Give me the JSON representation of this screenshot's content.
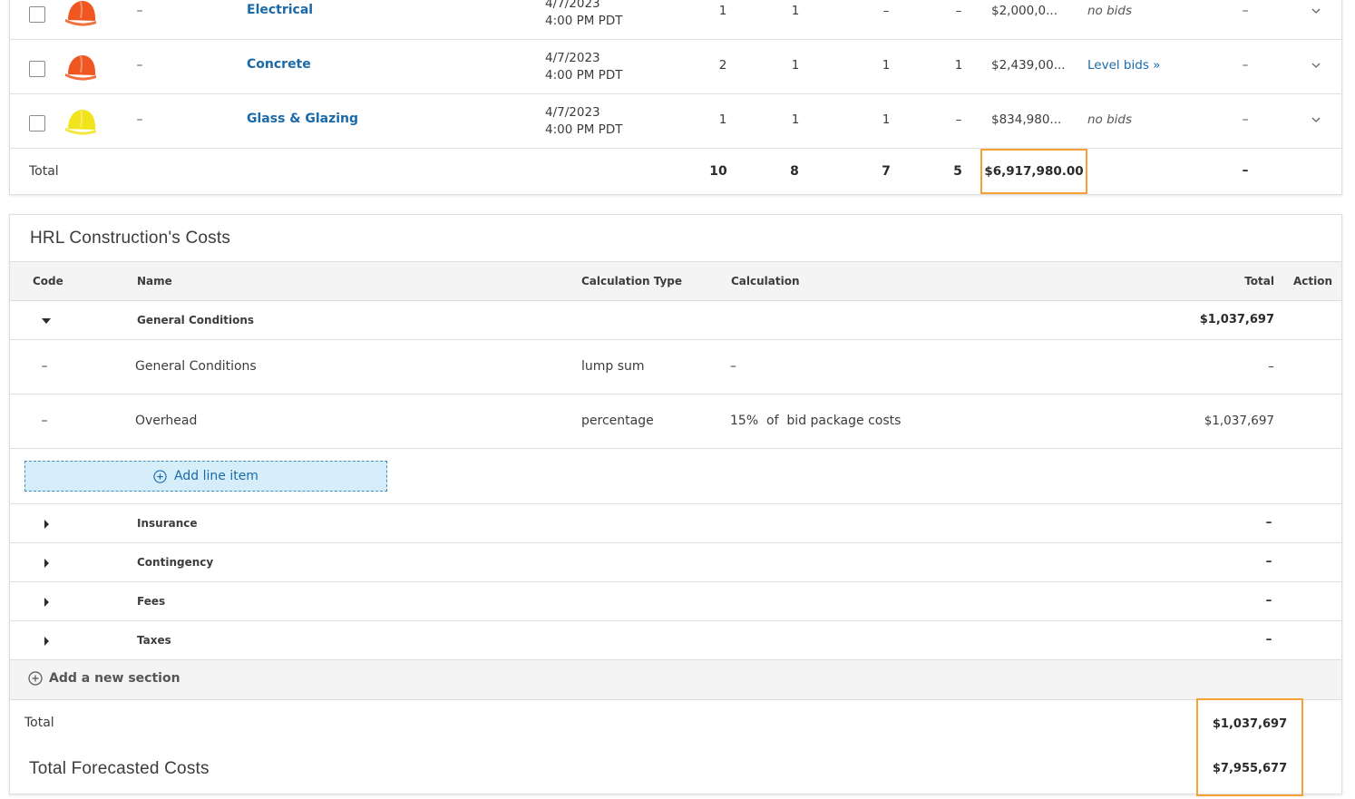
{
  "bid_packages": {
    "rows": [
      {
        "code": "–",
        "trade": "Electrical",
        "due_date": "4/7/2023",
        "due_time": "4:00 PM PDT",
        "c1": "1",
        "c2": "1",
        "c3": "–",
        "c4": "–",
        "amount": "$2,000,0...",
        "status": "no bids",
        "status_kind": "none",
        "extra": "–",
        "hat_color": "#f0561f"
      },
      {
        "code": "–",
        "trade": "Concrete",
        "due_date": "4/7/2023",
        "due_time": "4:00 PM PDT",
        "c1": "2",
        "c2": "1",
        "c3": "1",
        "c4": "1",
        "amount": "$2,439,00...",
        "status": "Level bids »",
        "status_kind": "link",
        "extra": "–",
        "hat_color": "#f0561f"
      },
      {
        "code": "–",
        "trade": "Glass & Glazing",
        "due_date": "4/7/2023",
        "due_time": "4:00 PM PDT",
        "c1": "1",
        "c2": "1",
        "c3": "1",
        "c4": "–",
        "amount": "$834,980...",
        "status": "no bids",
        "status_kind": "none",
        "extra": "–",
        "hat_color": "#f2e41c"
      }
    ],
    "total": {
      "label": "Total",
      "c1": "10",
      "c2": "8",
      "c3": "7",
      "c4": "5",
      "amount": "$6,917,980.00",
      "extra": "–"
    }
  },
  "costs": {
    "title": "HRL Construction's Costs",
    "headers": {
      "code": "Code",
      "name": "Name",
      "calc_type": "Calculation Type",
      "calculation": "Calculation",
      "total": "Total",
      "action": "Action"
    },
    "general_conditions": {
      "name": "General Conditions",
      "total": "$1,037,697",
      "items": [
        {
          "code": "–",
          "name": "General Conditions",
          "calc_type": "lump sum",
          "calculation": "–",
          "total": "–"
        },
        {
          "code": "–",
          "name": "Overhead",
          "calc_type": "percentage",
          "calculation": "15%  of  bid package costs",
          "total": "$1,037,697"
        }
      ],
      "add_line_label": "Add line item"
    },
    "sections": [
      {
        "name": "Insurance",
        "total": "–"
      },
      {
        "name": "Contingency",
        "total": "–"
      },
      {
        "name": "Fees",
        "total": "–"
      },
      {
        "name": "Taxes",
        "total": "–"
      }
    ],
    "add_section_label": "Add a new section",
    "total_label": "Total",
    "total_value": "$1,037,697",
    "forecast_label": "Total Forecasted Costs",
    "forecast_value": "$7,955,677"
  },
  "icons": {
    "hat": "hard-hat-icon",
    "chevron": "chevron-down-icon",
    "plus": "plus-circle-icon",
    "caret_down": "caret-down-icon",
    "caret_right": "caret-right-icon"
  },
  "colors": {
    "link": "#1a6aaa",
    "highlight_border": "#f5a136",
    "add_button_bg": "#d6eef9",
    "header_bg": "#f4f4f4"
  }
}
